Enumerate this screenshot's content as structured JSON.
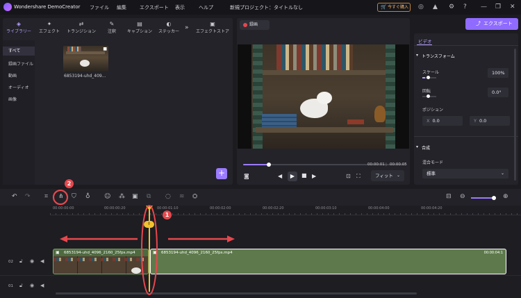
{
  "app": {
    "title": "Wondershare DemoCreator",
    "menu": [
      "ファイル",
      "編集",
      "エクスポート",
      "表示",
      "ヘルプ"
    ],
    "project_title": "新規プロジェクト：タイトルなし",
    "buy_label": "今すぐ購入"
  },
  "library": {
    "tabs": [
      {
        "label": "ライブラリー",
        "icon": "layers-icon"
      },
      {
        "label": "エフェクト",
        "icon": "effects-icon"
      },
      {
        "label": "トランジション",
        "icon": "transition-icon"
      },
      {
        "label": "注釈",
        "icon": "annotation-icon"
      },
      {
        "label": "キャプション",
        "icon": "caption-icon"
      },
      {
        "label": "ステッカー",
        "icon": "sticker-icon"
      },
      {
        "label": "エフェクトストア",
        "icon": "store-icon"
      }
    ],
    "more_label": "»",
    "sidebar": [
      "すべて",
      "録画ファイル",
      "動画",
      "オーディオ",
      "画像"
    ],
    "media_item": "6853194-uhd_409...",
    "add_label": "+"
  },
  "player": {
    "record_label": "録画",
    "time_current": "00:00:01",
    "time_total": "00:00:05",
    "progress": 0.16,
    "fit_label": "フィット"
  },
  "properties": {
    "export_label": "エクスポート",
    "tab_video": "ビデオ",
    "transform_label": "トランスフォーム",
    "scale_label": "スケール",
    "scale_value": "100%",
    "scale_level": 0.2,
    "rotate_label": "回転",
    "rotate_value": "0.0°",
    "position_label": "ポジション",
    "pos_x_label": "X",
    "pos_x": "0.0",
    "pos_y_label": "Y",
    "pos_y": "0.0",
    "composite_label": "合成",
    "blend_label": "混合モード",
    "blend_value": "標準"
  },
  "timeline": {
    "ruler_labels": [
      "00:00:00:00",
      "00:00:00:20",
      "00:00:01:10",
      "00:00:02:00",
      "00:00:02:20",
      "00:00:03:10",
      "00:00:04:00",
      "00:00:04:20"
    ],
    "track2_label": "02",
    "track1_label": "01",
    "clip_left_title": "6853194-uhd_4096_2160_25fps.mp4",
    "clip_right_title": "6853194-uhd_4096_2160_25fps.mp4",
    "clip_right_end": "00:00:04:1",
    "marker_1": "1",
    "marker_2": "2"
  }
}
